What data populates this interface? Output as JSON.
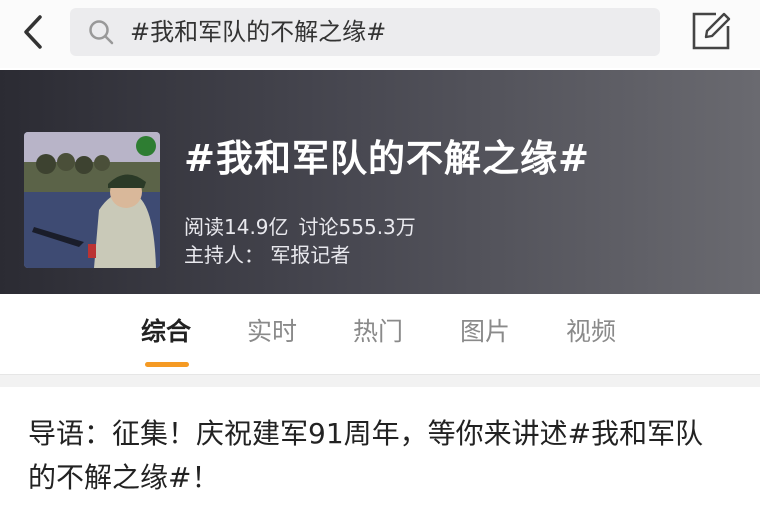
{
  "search": {
    "query": "#我和军队的不解之缘#"
  },
  "topic": {
    "title": "#我和军队的不解之缘#",
    "reads": "阅读14.9亿",
    "discussions": "讨论555.3万",
    "host": "主持人：  军报记者"
  },
  "tabs": [
    {
      "label": "综合"
    },
    {
      "label": "实时"
    },
    {
      "label": "热门"
    },
    {
      "label": "图片"
    },
    {
      "label": "视频"
    }
  ],
  "intro": {
    "text": "导语：征集！庆祝建军91周年，等你来讲述#我和军队的不解之缘#！"
  },
  "colors": {
    "accent": "#f59a23",
    "banner": "#474750"
  },
  "icons": [
    "back-arrow-icon",
    "search-icon",
    "compose-icon"
  ]
}
